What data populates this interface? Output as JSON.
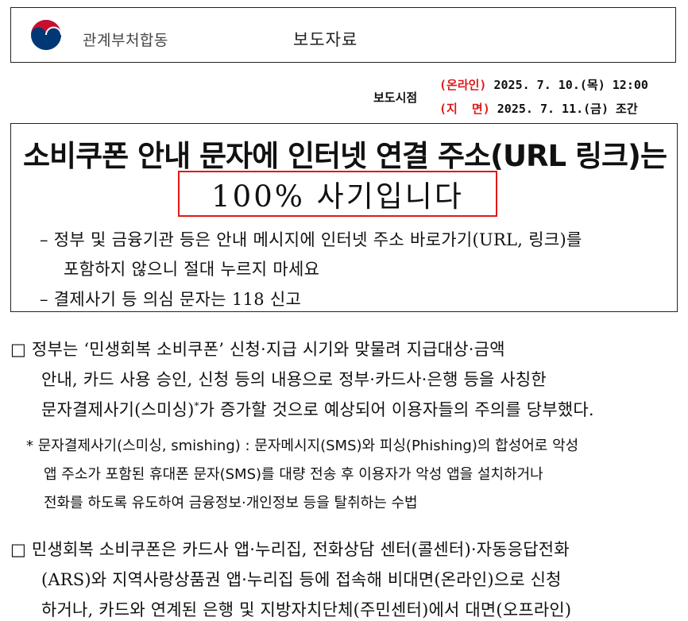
{
  "header": {
    "org_name": "관계부처합동",
    "doc_type": "보도자료"
  },
  "release": {
    "label": "보도시점",
    "online_tag": "(온라인)",
    "online_date": "2025. 7. 10.(목) 12:00",
    "print_tag": "(지  면)",
    "print_date": "2025. 7. 11.(금) 조간"
  },
  "summary": {
    "headline": "소비쿠폰 안내 문자에 인터넷 연결 주소(URL 링크)는",
    "headline2": "100% 사기입니다",
    "line1": "– 정부 및 금융기관 등은 안내 메시지에 인터넷 주소 바로가기(URL, 링크)를",
    "line2": "포함하지 않으니 절대 누르지 마세요",
    "line3": "– 결제사기 등 의심 문자는 118 신고"
  },
  "body": {
    "box_mark": "□",
    "p1_l1": " 정부는 ‘민생회복 소비쿠폰’ 신청·지급 시기와 맞물려 지급대상·금액",
    "p1_l2": "안내, 카드 사용 승인, 신청 등의 내용으로 정부·카드사·은행 등을 사칭한",
    "p1_l3a": "문자결제사기(스미싱)",
    "p1_l3sup": "*",
    "p1_l3b": "가 증가할 것으로 예상되어 이용자들의 주의를 당부했다.",
    "note_l1": "* 문자결제사기(스미싱, smishing) : 문자메시지(SMS)와 피싱(Phishing)의 합성어로 악성",
    "note_l2": "앱 주소가 포함된 휴대폰 문자(SMS)를 대량 전송 후 이용자가 악성 앱을 설치하거나",
    "note_l3": "전화를 하도록 유도하여 금융정보·개인정보 등을 탈취하는 수법",
    "p2_l1": " 민생회복 소비쿠폰은 카드사 앱·누리집, 전화상담 센터(콜센터)·자동응답전화",
    "p2_l2": "(ARS)와 지역사랑상품권 앱·누리집 등에 접속해 비대면(온라인)으로 신청",
    "p2_l3": "하거나, 카드와 연계된 은행 및 지방자치단체(주민센터)에서 대면(오프라인)"
  },
  "colors": {
    "accent_red": "#e01919",
    "logo_red": "#c8102e",
    "logo_blue": "#003876"
  }
}
